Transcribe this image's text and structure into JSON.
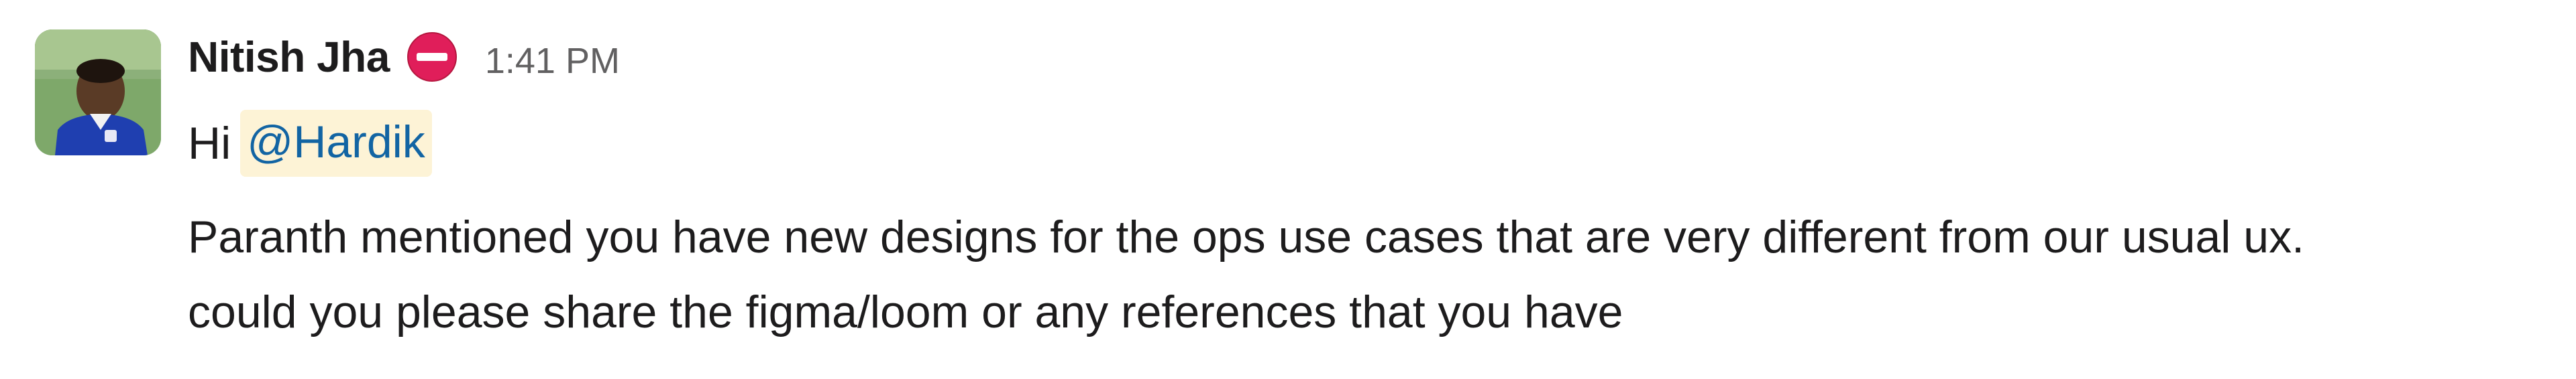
{
  "message": {
    "sender": {
      "name": "Nitish Jha",
      "status_icon": "no-entry-icon"
    },
    "timestamp": "1:41 PM",
    "greeting": "Hi",
    "mention": "@Hardik",
    "body_line_1": "Paranth mentioned you have new designs for the ops use cases that are very different from our usual ux.",
    "body_line_2": "could you please share the figma/loom or any references that you have"
  },
  "colors": {
    "mention_text": "#1264a3",
    "mention_background": "#fdf3d6",
    "status_red": "#e01e5a",
    "timestamp_gray": "#616061"
  }
}
